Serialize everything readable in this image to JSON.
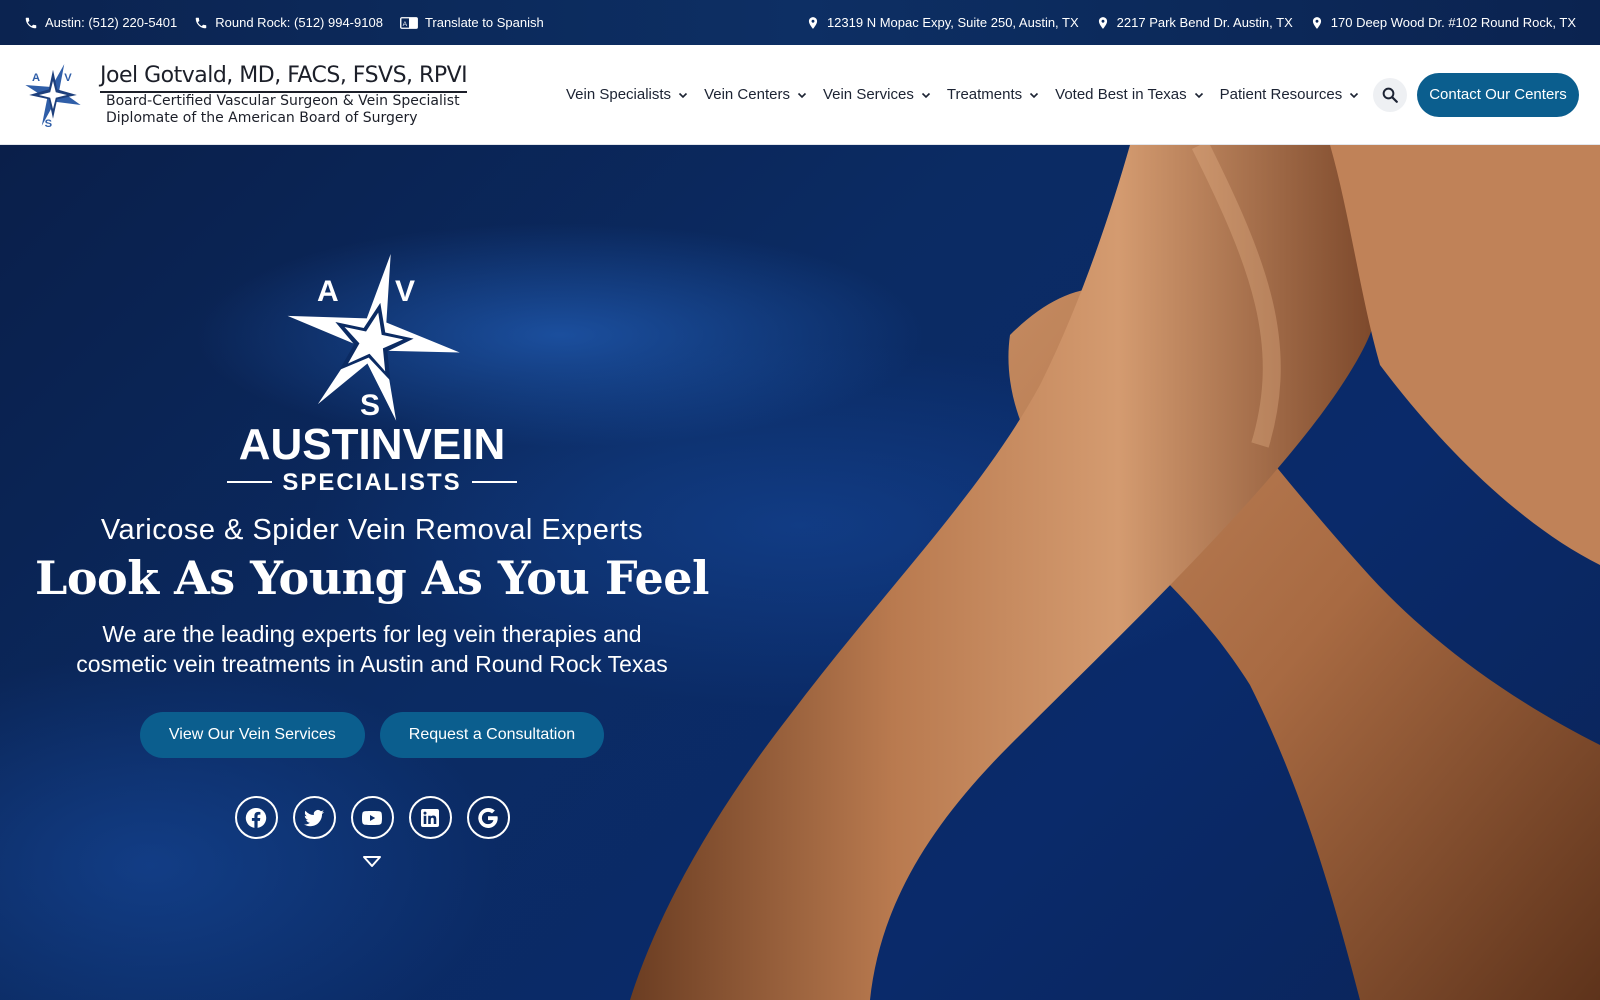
{
  "topbar": {
    "phones": [
      {
        "label": "Austin: (512) 220-5401"
      },
      {
        "label": "Round Rock: (512) 994-9108"
      }
    ],
    "translate": "Translate to Spanish",
    "addresses": [
      {
        "label": "12319 N Mopac Expy, Suite 250, Austin, TX"
      },
      {
        "label": "2217 Park Bend Dr. Austin, TX"
      },
      {
        "label": "170 Deep Wood Dr. #102 Round Rock, TX"
      }
    ]
  },
  "brand": {
    "name": "Joel Gotvald, MD, FACS, FSVS, RPVI",
    "line1": "Board-Certified Vascular Surgeon & Vein Specialist",
    "line2": "Diplomate of the American Board of Surgery",
    "logo_letters": [
      "A",
      "V",
      "S"
    ]
  },
  "nav": {
    "items": [
      {
        "label": "Vein Specialists"
      },
      {
        "label": "Vein Centers"
      },
      {
        "label": "Vein Services"
      },
      {
        "label": "Treatments"
      },
      {
        "label": "Voted Best in Texas"
      },
      {
        "label": "Patient Resources"
      }
    ],
    "contact": "Contact Our Centers"
  },
  "hero": {
    "logo_letters": [
      "A",
      "V",
      "S"
    ],
    "logo_word1": "AUSTINVEIN",
    "logo_word2": "SPECIALISTS",
    "tagline": "Varicose & Spider Vein Removal Experts",
    "headline": "Look As Young As You Feel",
    "desc_line1": "We are the leading experts for leg vein therapies and",
    "desc_line2": "cosmetic vein treatments in Austin and Round Rock Texas",
    "btn_services": "View Our Vein Services",
    "btn_consult": "Request a Consultation"
  },
  "socials": [
    "facebook-icon",
    "twitter-icon",
    "youtube-icon",
    "linkedin-icon",
    "google-icon"
  ],
  "colors": {
    "accent": "#0b5e8e",
    "topbar": "#0b2350",
    "hero_bg": "#0a1f4a",
    "skin": "#c48a60"
  }
}
